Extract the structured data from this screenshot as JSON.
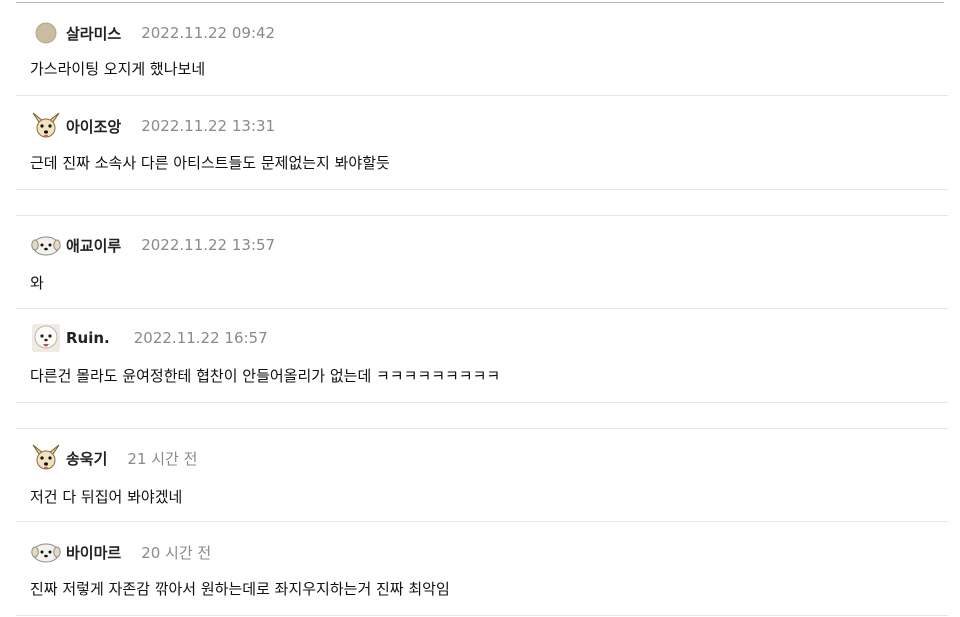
{
  "comments": [
    {
      "nickname": "살라미스",
      "date": "2022.11.22 09:42",
      "text": "가스라이팅 오지게 했나보네",
      "avatar": "dot-icon"
    },
    {
      "nickname": "아이조앙",
      "date": "2022.11.22 13:31",
      "text": "근데 진짜 소속사 다른 아티스트들도 문제없는지 봐야할듯",
      "avatar": "chihuahua-icon"
    },
    {
      "nickname": "애교이루",
      "date": "2022.11.22 13:57",
      "text": "와",
      "avatar": "maltese-icon"
    },
    {
      "nickname": "Ruin.",
      "date": "2022.11.22 16:57",
      "text": "다른건 몰라도 윤여정한테 협찬이 안들어올리가 없는데 ㅋㅋㅋㅋㅋㅋㅋㅋㅋ",
      "avatar": "bichon-icon"
    },
    {
      "nickname": "송욱기",
      "date": "21 시간 전",
      "text": "저건 다 뒤집어 봐야겠네",
      "avatar": "chihuahua-icon"
    },
    {
      "nickname": "바이마르",
      "date": "20 시간 전",
      "text": "진짜 저렇게 자존감 깎아서 원하는데로 좌지우지하는거 진짜 최악임",
      "avatar": "maltese-icon"
    }
  ],
  "colors": {
    "nickname": "#222222",
    "date": "#8a8a8a",
    "text": "#111111",
    "divider": "#e6e6e6"
  }
}
